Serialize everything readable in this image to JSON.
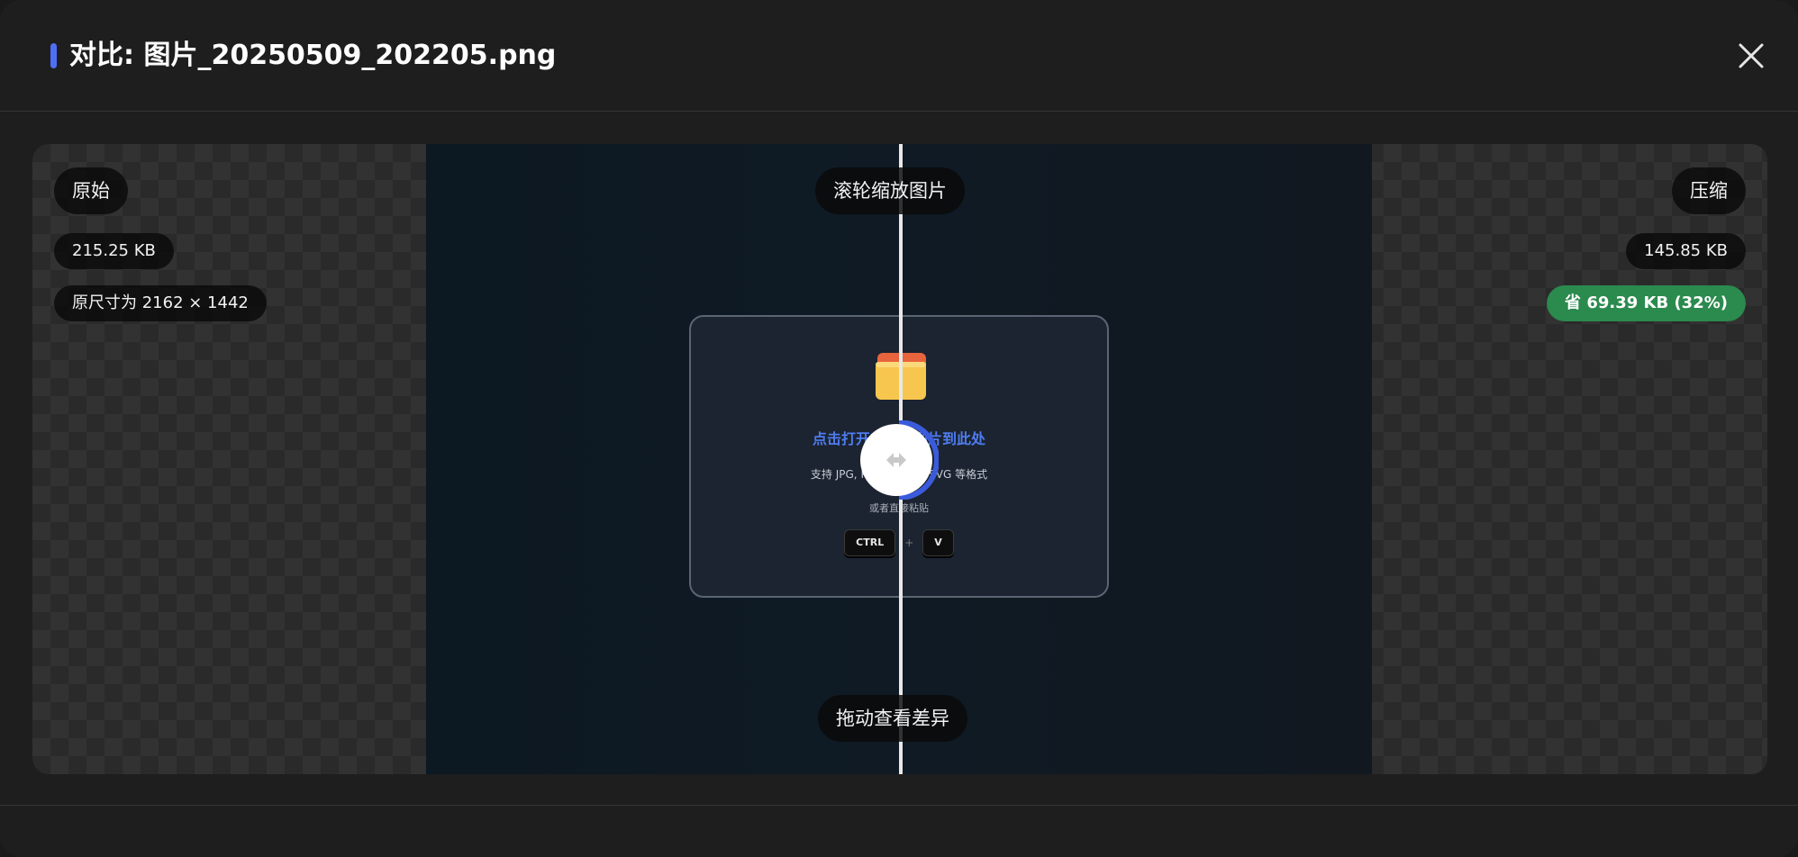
{
  "header": {
    "title": "对比: 图片_20250509_202205.png",
    "accent_color": "#4f6ef7",
    "close_icon": "close-icon"
  },
  "original": {
    "label": "原始",
    "size": "215.25 KB",
    "dimensions": "原尺寸为 2162 × 1442"
  },
  "compressed": {
    "label": "压缩",
    "size": "145.85 KB",
    "saved": "省 69.39 KB (32%)",
    "saved_color": "#2b8a4e"
  },
  "hints": {
    "zoom": "滚轮缩放图片",
    "drag": "拖动查看差异"
  },
  "preview": {
    "dropzone_title": "点击打开或拖拽图片到此处",
    "formats": "支持 JPG, PNG, WEBP, SVG 等格式",
    "paste_hint": "或者直接粘贴",
    "keys": [
      "CTRL",
      "+",
      "V"
    ],
    "folder_icon": "folder-icon"
  },
  "slider": {
    "icon": "drag-arrows-icon",
    "accent_color": "#3b5bdb"
  }
}
